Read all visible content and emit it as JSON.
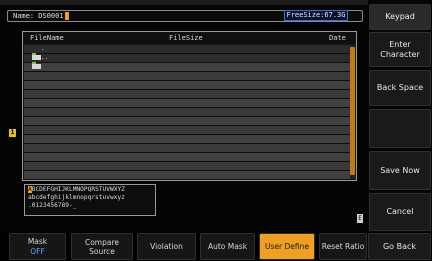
{
  "name_bar": {
    "label": "Name: DS0001"
  },
  "freesize": "FreeSize:67.3G",
  "file_list": {
    "headers": {
      "file_name": "FileName",
      "file_size": "FileSize",
      "date": "Date"
    },
    "rows": [
      {
        "name": "."
      },
      {
        "name": ".."
      }
    ]
  },
  "char_palette": {
    "selected_char": "A",
    "line1_rest": "BCDEFGHIJKLMNOPQRSTUVWXYZ",
    "line2": "abcdefghijklmnopqrstuvwxyz",
    "line3": ".0123456789-_"
  },
  "channel_marker": "1",
  "right_marker": "E",
  "side_menu": {
    "title": "Keypad",
    "enter_character": "Enter Character",
    "back_space": "Back Space",
    "save_now": "Save Now",
    "cancel": "Cancel"
  },
  "bottom_menu": {
    "mask": {
      "label": "Mask",
      "value": "OFF"
    },
    "compare_source": "Compare Source",
    "violation": "Violation",
    "auto_mask": "Auto Mask",
    "user_define": "User Define",
    "reset_ratio": "Reset Ratio",
    "go_back": "Go Back"
  },
  "colors": {
    "accent": "#f0a020",
    "value_blue": "#5ea8ff",
    "channel1": "#e8c400",
    "freesize_border": "#3b6bd8"
  }
}
